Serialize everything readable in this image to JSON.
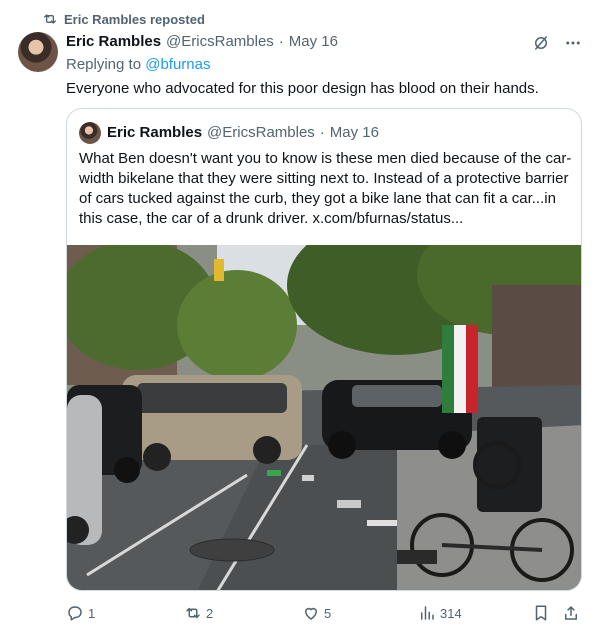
{
  "repost": {
    "label": "Eric Rambles reposted"
  },
  "tweet": {
    "author_name": "Eric Rambles",
    "author_handle": "@EricsRambles",
    "dot": "·",
    "date": "May 16",
    "replying_prefix": "Replying to",
    "replying_to": "@bfurnas",
    "text": "Everyone who advocated for this poor design has blood on their hands."
  },
  "quote": {
    "author_name": "Eric Rambles",
    "author_handle": "@EricsRambles",
    "dot": "·",
    "date": "May 16",
    "text": "What Ben doesn't want you to know is these men died because of the car-width bikelane that they were sitting next to. Instead of a protective barrier of cars tucked against the curb, they got a bike lane that can fit a car...in this case, the car of a drunk driver.  x.com/bfurnas/status..."
  },
  "actions": {
    "replies": "1",
    "reposts": "2",
    "likes": "5",
    "views": "314"
  },
  "icons": [
    "repost-icon",
    "grok-icon",
    "more-icon",
    "reply-icon",
    "like-icon",
    "views-icon",
    "bookmark-icon",
    "share-icon"
  ],
  "colors": {
    "link": "#1d9bf0",
    "muted": "#536471",
    "text": "#0f1419",
    "border": "#cfd9de"
  }
}
